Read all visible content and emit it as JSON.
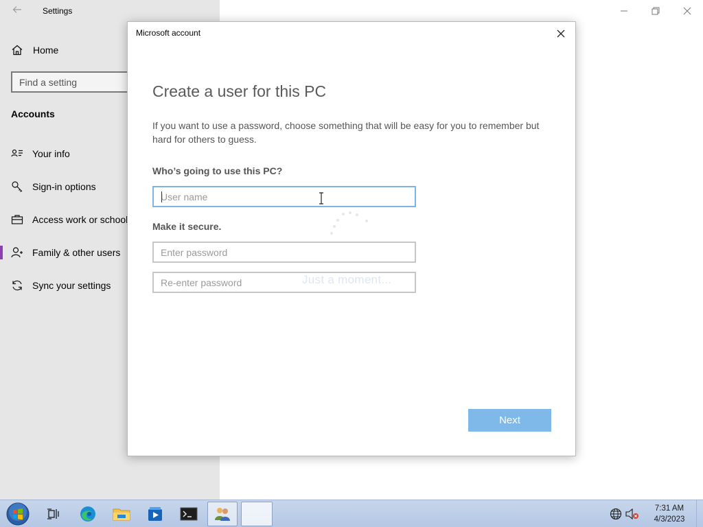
{
  "settings": {
    "title": "Settings",
    "home_label": "Home",
    "search_placeholder": "Find a setting",
    "section_title": "Accounts",
    "nav": [
      {
        "label": "Your info",
        "icon": "person-card-icon"
      },
      {
        "label": "Sign-in options",
        "icon": "key-icon"
      },
      {
        "label": "Access work or school",
        "icon": "briefcase-icon"
      },
      {
        "label": "Family & other users",
        "icon": "add-person-icon"
      },
      {
        "label": "Sync your settings",
        "icon": "sync-icon"
      }
    ],
    "active_nav_color": "#8b3fb3"
  },
  "dialog": {
    "title": "Microsoft account",
    "heading": "Create a user for this PC",
    "description": "If you want to use a password, choose something that will be easy for you to remember but hard for others to guess.",
    "who_label": "Who’s going to use this PC?",
    "username_placeholder": "User name",
    "secure_label": "Make it secure.",
    "password_placeholder": "Enter password",
    "reenter_placeholder": "Re-enter password",
    "loading_text": "Just a moment...",
    "next_label": "Next",
    "accent_color": "#7eb9ea"
  },
  "taskbar": {
    "apps": [
      "start-orb-icon",
      "task-view-icon",
      "edge-icon",
      "file-explorer-icon",
      "media-player-icon",
      "terminal-icon",
      "users-icon",
      "blank-window"
    ],
    "time": "7:31 AM",
    "date": "4/3/2023"
  }
}
